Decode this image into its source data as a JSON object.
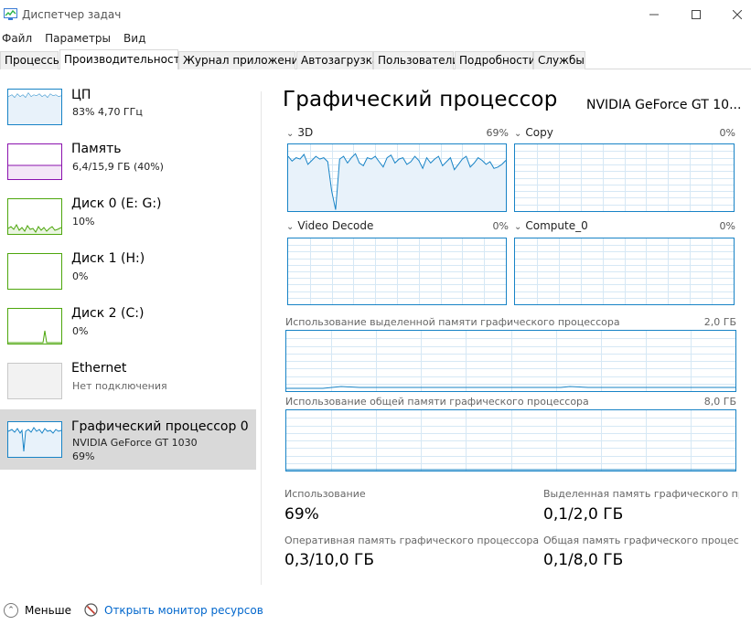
{
  "window": {
    "title": "Диспетчер задач"
  },
  "menu": [
    "Файл",
    "Параметры",
    "Вид"
  ],
  "tabs": [
    "Процессы",
    "Производительность",
    "Журнал приложений",
    "Автозагрузка",
    "Пользователи",
    "Подробности",
    "Службы"
  ],
  "active_tab": "Производительность",
  "sidebar": {
    "items": [
      {
        "title": "ЦП",
        "sub1": "83% 4,70 ГГц",
        "sub2": ""
      },
      {
        "title": "Память",
        "sub1": "6,4/15,9 ГБ (40%)",
        "sub2": ""
      },
      {
        "title": "Диск 0 (E: G:)",
        "sub1": "10%",
        "sub2": ""
      },
      {
        "title": "Диск 1 (H:)",
        "sub1": "0%",
        "sub2": ""
      },
      {
        "title": "Диск 2 (C:)",
        "sub1": "0%",
        "sub2": ""
      },
      {
        "title": "Ethernet",
        "sub1": "Нет подключения",
        "sub2": ""
      },
      {
        "title": "Графический процессор 0",
        "sub1": "NVIDIA GeForce GT 1030",
        "sub2": "69%"
      }
    ],
    "selected": "Графический процессор 0"
  },
  "main": {
    "title": "Графический процессор",
    "model": "NVIDIA GeForce GT 10...",
    "engines": [
      {
        "name": "3D",
        "pct": "69%"
      },
      {
        "name": "Copy",
        "pct": "0%"
      },
      {
        "name": "Video Decode",
        "pct": "0%"
      },
      {
        "name": "Compute_0",
        "pct": "0%"
      }
    ],
    "dedicated_mem": {
      "label": "Использование выделенной памяти графического процессора",
      "max": "2,0 ГБ"
    },
    "shared_mem": {
      "label": "Использование общей памяти графического процессора",
      "max": "8,0 ГБ"
    },
    "stats": {
      "usage_label": "Использование",
      "usage_value": "69%",
      "dedicated_label": "Выделенная память графического процессора",
      "dedicated_value": "0,1/2,0 ГБ",
      "gpu_mem_label": "Оперативная память графического процессора",
      "gpu_mem_value": "0,3/10,0 ГБ",
      "shared_label": "Общая память графического процессора",
      "shared_value": "0,1/8,0 ГБ"
    }
  },
  "footer": {
    "less": "Меньше",
    "link": "Открыть монитор ресурсов"
  },
  "colors": {
    "gpu": "#1783c6",
    "memory": "#8b12ae",
    "disk": "#4da60c",
    "ethernet": "#a7a7a7",
    "selected": "#d9d9d9"
  },
  "chart_data": {
    "type": "line",
    "title": "3D",
    "ylim": [
      0,
      100
    ],
    "series": [
      {
        "values": [
          82,
          75,
          80,
          78,
          85,
          70,
          76,
          82,
          78,
          80,
          74,
          30,
          2,
          78,
          82,
          72,
          80,
          86,
          72,
          68,
          80,
          78,
          82,
          74,
          66,
          80,
          84,
          72,
          78,
          80,
          70,
          74,
          82,
          76,
          64,
          80,
          72,
          78,
          82,
          68,
          74,
          80,
          62,
          70,
          78,
          82,
          66,
          72,
          80,
          76,
          70,
          74,
          64,
          66,
          70,
          76
        ]
      }
    ]
  }
}
